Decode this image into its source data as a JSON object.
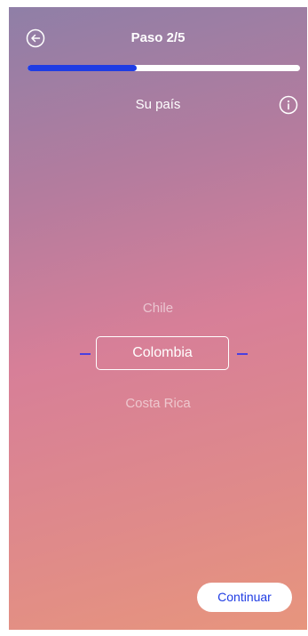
{
  "header": {
    "back_icon": "arrow-left-circle-icon",
    "step_title": "Paso 2/5",
    "progress": {
      "current": 2,
      "total": 5,
      "fraction": 0.4
    },
    "progress_color": "#1f3ce4"
  },
  "question": {
    "label": "Su país",
    "info_icon": "info-circle-icon"
  },
  "country_picker": {
    "previous": "Chile",
    "selected": "Colombia",
    "next": "Costa Rica"
  },
  "footer": {
    "continue_label": "Continuar"
  },
  "colors": {
    "accent": "#1f3ce4",
    "gradient_top": "#8f7fa7",
    "gradient_middle": "#d77f98",
    "gradient_bottom": "#e7957d"
  }
}
